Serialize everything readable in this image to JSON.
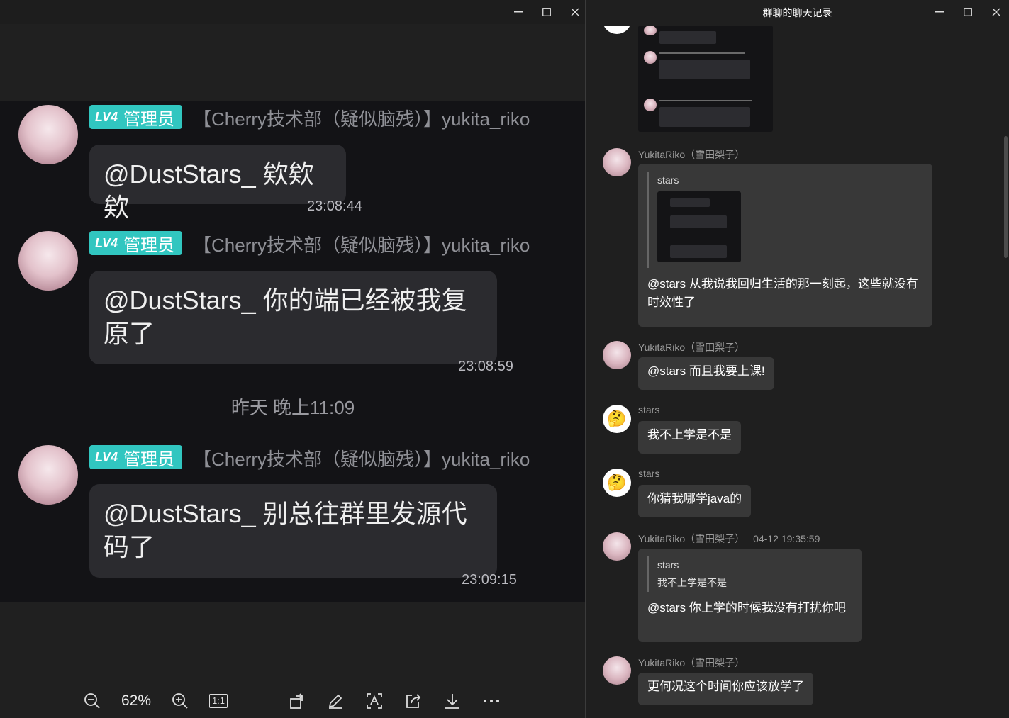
{
  "viewer": {
    "zoom": "62%",
    "actual_size": "1:1",
    "messages": [
      {
        "badge_lv": "LV4",
        "badge_role": "管理员",
        "name": "【Cherry技术部（疑似脑残）】yukita_riko",
        "text": "@DustStars_ 欸欸欸",
        "time": "23:08:44"
      },
      {
        "badge_lv": "LV4",
        "badge_role": "管理员",
        "name": "【Cherry技术部（疑似脑残）】yukita_riko",
        "text": "@DustStars_ 你的端已经被我复原了",
        "time": "23:08:59"
      },
      {
        "badge_lv": "LV4",
        "badge_role": "管理员",
        "name": "【Cherry技术部（疑似脑残）】yukita_riko",
        "text": "@DustStars_ 别总往群里发源代码了",
        "time": "23:09:15"
      }
    ],
    "separator": "昨天 晚上11:09"
  },
  "history": {
    "title": "群聊的聊天记录",
    "messages": [
      {
        "name": "YukitaRiko（雪田梨子）",
        "quote_name": "stars",
        "text": "@stars 从我说我回归生活的那一刻起，这些就没有时效性了"
      },
      {
        "name": "YukitaRiko（雪田梨子）",
        "text": "@stars 而且我要上课!"
      },
      {
        "name": "stars",
        "avatar": "🤔",
        "text": "我不上学是不是"
      },
      {
        "name": "stars",
        "avatar": "🤔",
        "text": "你猜我哪学java的"
      },
      {
        "name": "YukitaRiko（雪田梨子）",
        "time": "04-12 19:35:59",
        "quote_name": "stars",
        "quote_text": "我不上学是不是",
        "text": "@stars 你上学的时候我没有打扰你吧"
      },
      {
        "name": "YukitaRiko（雪田梨子）",
        "text": "更何况这个时间你应该放学了"
      }
    ]
  },
  "colors": {
    "badge": "#31c6c0",
    "bubble_left": "#2b2b2f",
    "bubble_right": "#383838"
  }
}
